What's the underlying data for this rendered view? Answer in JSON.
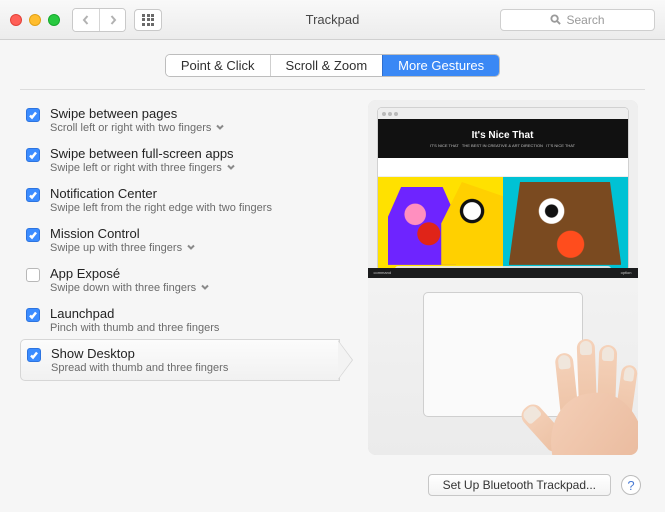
{
  "window": {
    "title": "Trackpad"
  },
  "search": {
    "placeholder": "Search"
  },
  "tabs": [
    {
      "label": "Point & Click",
      "active": false
    },
    {
      "label": "Scroll & Zoom",
      "active": false
    },
    {
      "label": "More Gestures",
      "active": true
    }
  ],
  "options": [
    {
      "title": "Swipe between pages",
      "desc": "Scroll left or right with two fingers",
      "checked": true,
      "hasDropdown": true
    },
    {
      "title": "Swipe between full-screen apps",
      "desc": "Swipe left or right with three fingers",
      "checked": true,
      "hasDropdown": true
    },
    {
      "title": "Notification Center",
      "desc": "Swipe left from the right edge with two fingers",
      "checked": true,
      "hasDropdown": false
    },
    {
      "title": "Mission Control",
      "desc": "Swipe up with three fingers",
      "checked": true,
      "hasDropdown": true
    },
    {
      "title": "App Exposé",
      "desc": "Swipe down with three fingers",
      "checked": false,
      "hasDropdown": true
    },
    {
      "title": "Launchpad",
      "desc": "Pinch with thumb and three fingers",
      "checked": true,
      "hasDropdown": false
    },
    {
      "title": "Show Desktop",
      "desc": "Spread with thumb and three fingers",
      "checked": true,
      "hasDropdown": false,
      "selected": true
    }
  ],
  "preview": {
    "site_title": "It's Nice That",
    "key_left": "command",
    "key_right": "option",
    "tagline": ""
  },
  "footer": {
    "button": "Set Up Bluetooth Trackpad...",
    "help": "?"
  }
}
